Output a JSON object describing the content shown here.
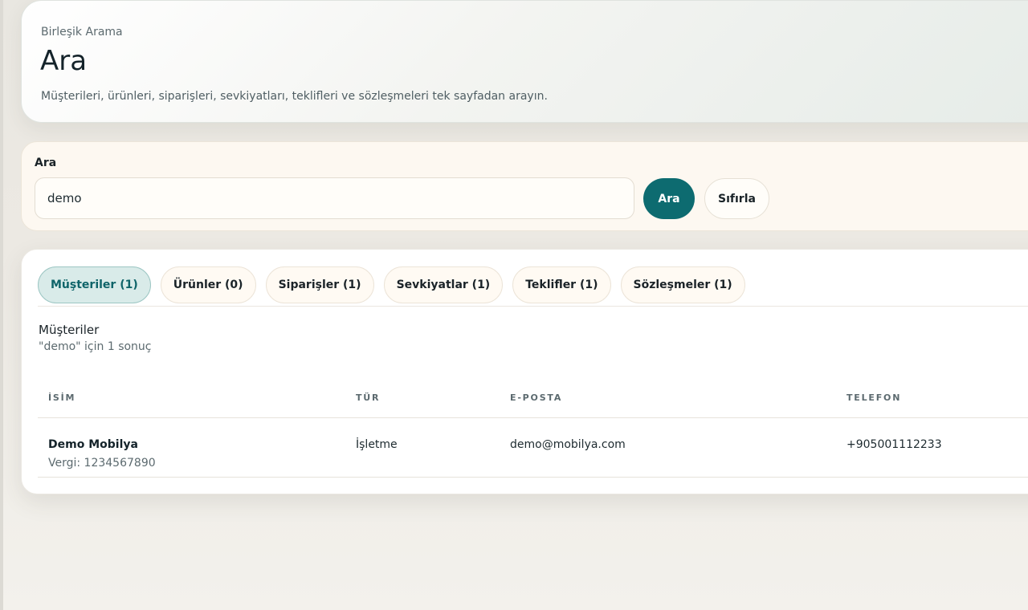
{
  "header": {
    "eyebrow": "Birleşik Arama",
    "title": "Ara",
    "subtitle": "Müşterileri, ürünleri, siparişleri, sevkiyatları, teklifleri ve sözleşmeleri tek sayfadan arayın."
  },
  "search": {
    "label": "Ara",
    "value": "demo",
    "submit_label": "Ara",
    "reset_label": "Sıfırla"
  },
  "tabs": [
    {
      "label": "Müşteriler (1)",
      "active": true
    },
    {
      "label": "Ürünler (0)",
      "active": false
    },
    {
      "label": "Siparişler (1)",
      "active": false
    },
    {
      "label": "Sevkiyatlar (1)",
      "active": false
    },
    {
      "label": "Teklifler (1)",
      "active": false
    },
    {
      "label": "Sözleşmeler (1)",
      "active": false
    }
  ],
  "results": {
    "section_title": "Müşteriler",
    "summary": "\"demo\" için 1 sonuç",
    "columns": [
      "İSİM",
      "TÜR",
      "E-POSTA",
      "TELEFON"
    ],
    "rows": [
      {
        "name": "Demo Mobilya",
        "tax": "Vergi: 1234567890",
        "type": "İşletme",
        "email": "demo@mobilya.com",
        "phone": "+905001112233"
      }
    ]
  },
  "colors": {
    "accent": "#0d6b70",
    "active_tab_bg": "#d9ebe9",
    "card_cream": "#fdf8f1"
  }
}
